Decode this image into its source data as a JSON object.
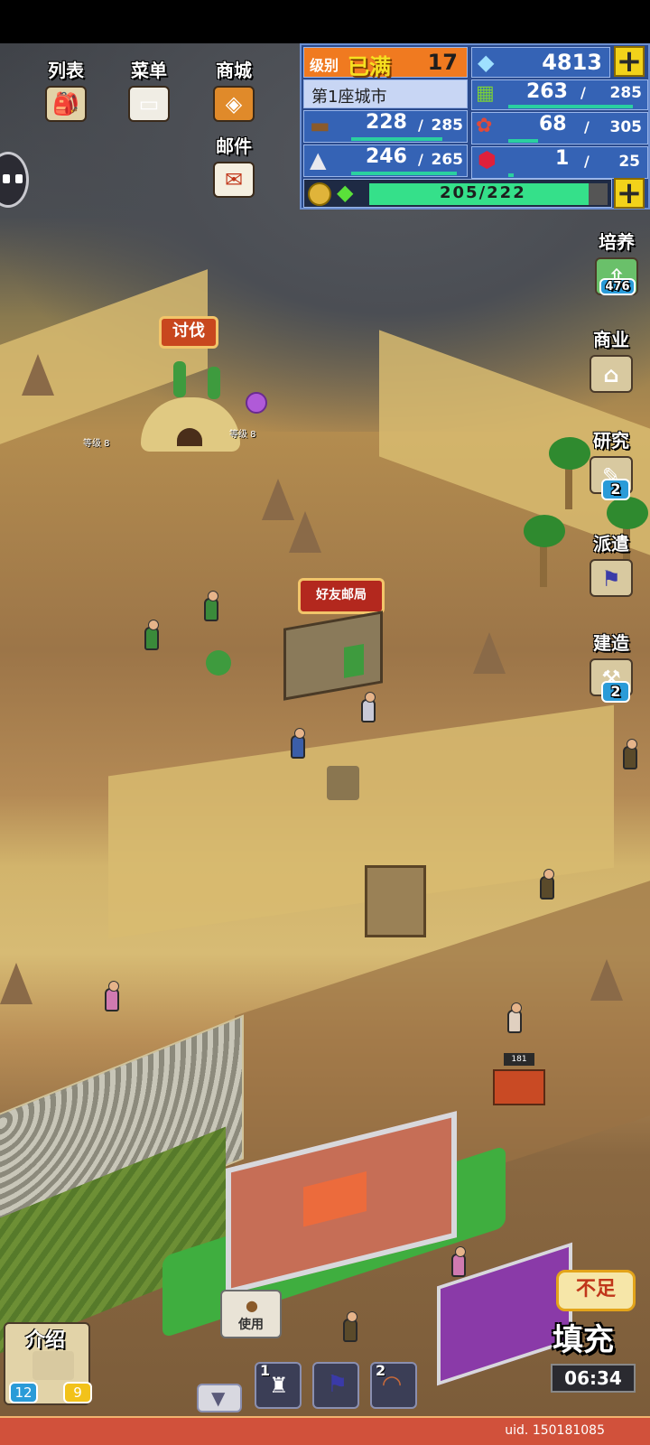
{
  "top_menu": {
    "list_label": "列表",
    "menu_label": "菜单",
    "shop_label": "商城",
    "mail_label": "邮件"
  },
  "resources": {
    "level_label": "级别",
    "level_badge": "已满",
    "level_value": "17",
    "gems": "4813",
    "city_name": "第1座城市",
    "food_current": "263",
    "food_max": "285",
    "food_fill": 0.92,
    "wood_current": "228",
    "wood_max": "285",
    "wood_fill": 0.8,
    "cloth_current": "68",
    "cloth_max": "305",
    "cloth_fill": 0.22,
    "stone_current": "246",
    "stone_max": "265",
    "stone_fill": 0.93,
    "ruby_current": "1",
    "ruby_max": "25",
    "ruby_fill": 0.04,
    "exp_text": "205/222",
    "exp_fill": 0.92,
    "separator": "/"
  },
  "right_menu": {
    "train_label": "培养",
    "train_count": "476",
    "business_label": "商业",
    "research_label": "研究",
    "research_badge": "2",
    "dispatch_label": "派遣",
    "build_label": "建造",
    "build_badge": "2"
  },
  "map": {
    "expedition_sign": "讨伐",
    "post_office_sign": "好友邮局",
    "level_tag_1": "等级 8",
    "level_tag_2": "等级 8",
    "small_building_num": "181"
  },
  "bottom": {
    "intro_label": "介绍",
    "intro_badge_left": "12",
    "intro_badge_right": "9",
    "use_label": "使用",
    "slot1_num": "1",
    "slot2_num": "2",
    "fill_tag": "不足",
    "fill_label": "填充",
    "fill_timer": "06:34",
    "uid_text": "uid. 150181085"
  },
  "colors": {
    "panel_blue": "#2a4a8c",
    "level_orange": "#f07a20",
    "plus_yellow": "#f2d21a",
    "exp_green": "#35e08a"
  }
}
